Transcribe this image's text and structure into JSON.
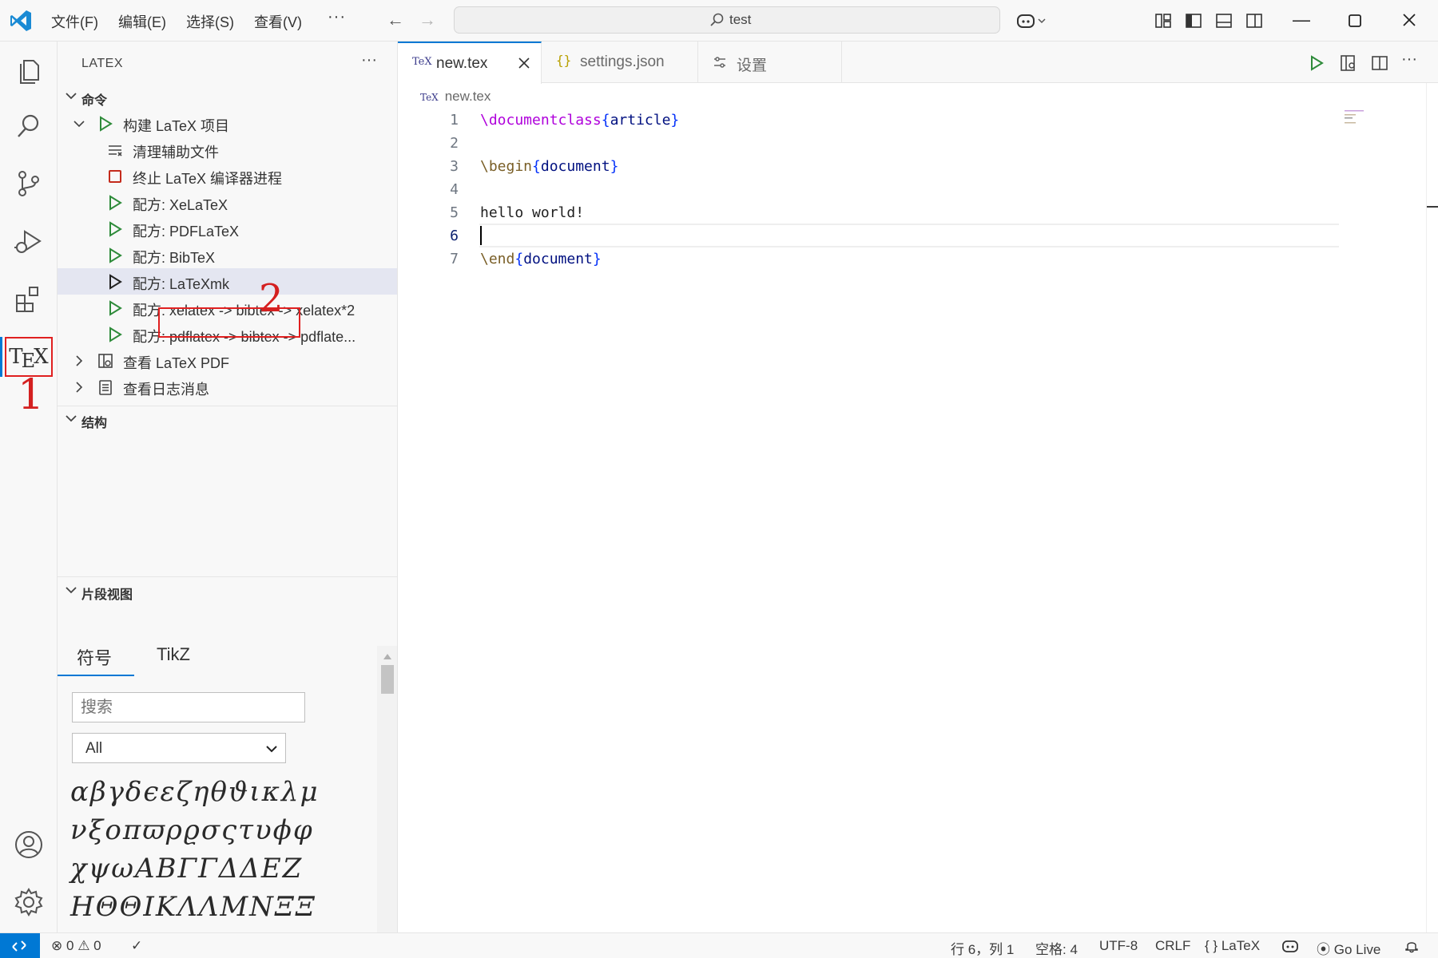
{
  "titlebar": {
    "menus": [
      "文件(F)",
      "编辑(E)",
      "选择(S)",
      "查看(V)"
    ],
    "more": "···",
    "search_text": "test"
  },
  "sidebar": {
    "title": "LATEX",
    "more": "···",
    "commands_section": "命令",
    "commands": [
      {
        "label": "构建 LaTeX 项目",
        "icon": "run-icon"
      },
      {
        "label": "清理辅助文件",
        "icon": "clear-icon"
      },
      {
        "label": "终止 LaTeX 编译器进程",
        "icon": "stop-icon"
      },
      {
        "label": "配方: XeLaTeX",
        "icon": "run-icon"
      },
      {
        "label": "配方: PDFLaTeX",
        "icon": "run-icon"
      },
      {
        "label": "配方: BibTeX",
        "icon": "run-icon"
      },
      {
        "label": "配方: LaTeXmk",
        "icon": "run-icon"
      },
      {
        "label": "配方: xelatex -> bibtex -> xelatex*2",
        "icon": "run-icon"
      },
      {
        "label": "配方: pdflatex -> bibtex -> pdflate...",
        "icon": "run-icon"
      },
      {
        "label": "查看 LaTeX PDF",
        "icon": "pdf-view-icon"
      },
      {
        "label": "查看日志消息",
        "icon": "log-icon"
      }
    ],
    "structure_section": "结构",
    "snippet_section": "片段视图",
    "snippet_tabs": [
      "符号",
      "TikZ"
    ],
    "snippet_search_placeholder": "搜索",
    "snippet_filter": "All",
    "symbols": "αβγδϵεζηθϑικλμνξοπϖρϱσςτυϕφχψωΑΒΓΓΔΔΕΖΗΘΘΙΚΛΛΜΝΞΞΟΠΠΡΣΣ"
  },
  "annotations": {
    "first": "1",
    "second": "2"
  },
  "editor": {
    "tabs": [
      {
        "label": "new.tex",
        "icon": "TeX",
        "active": true
      },
      {
        "label": "settings.json",
        "icon": "{}",
        "active": false
      },
      {
        "label": "设置",
        "icon": "settings-icon",
        "active": false
      }
    ],
    "breadcrumb": "new.tex",
    "breadcrumb_icon": "TeX",
    "lines": [
      {
        "n": "1",
        "text": "\\documentclass{article}"
      },
      {
        "n": "2",
        "text": ""
      },
      {
        "n": "3",
        "text": "\\begin{document}"
      },
      {
        "n": "4",
        "text": ""
      },
      {
        "n": "5",
        "text": "hello world!"
      },
      {
        "n": "6",
        "text": ""
      },
      {
        "n": "7",
        "text": "\\end{document}"
      }
    ],
    "current_line": "6"
  },
  "statusbar": {
    "errors": "0",
    "warnings": "0",
    "position": "行 6，列 1",
    "spaces": "空格: 4",
    "encoding": "UTF-8",
    "eol": "CRLF",
    "language_icon": "{ }",
    "language": "LaTeX",
    "golive": "Go Live"
  },
  "colors": {
    "accent": "#0078d4",
    "annotation": "#e02020",
    "run_green": "#2e8b3a",
    "stop_red": "#c42b1c",
    "latex_command": "#795e26",
    "latex_brace": "#0431fa",
    "latex_arg": "#001080"
  }
}
